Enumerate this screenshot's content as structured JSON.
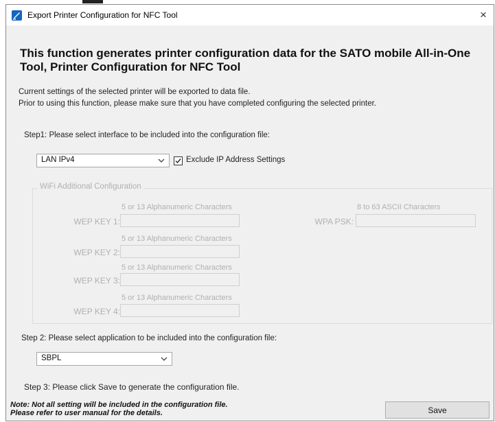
{
  "window": {
    "title": "Export Printer Configuration for NFC Tool",
    "close_glyph": "×"
  },
  "heading": "This function generates printer configuration data for the SATO mobile All-in-One Tool, Printer Configuration for NFC Tool",
  "description": {
    "line1": "Current settings of the selected printer will be exported to data file.",
    "line2": "Prior to using this function, please make sure that you have completed configuring the selected printer."
  },
  "step1": {
    "label": "Step1: Please select interface to be included into the configuration file:",
    "interface_value": "LAN IPv4",
    "exclude_ip": {
      "label": "Exclude IP Address Settings",
      "checked": true
    }
  },
  "wifi": {
    "group_title": "WiFi Additional Configuration",
    "wep_hint": "5 or 13 Alphanumeric Characters",
    "wep_keys": [
      {
        "label": "WEP KEY 1:",
        "value": ""
      },
      {
        "label": "WEP KEY 2:",
        "value": ""
      },
      {
        "label": "WEP KEY 3:",
        "value": ""
      },
      {
        "label": "WEP KEY 4:",
        "value": ""
      }
    ],
    "wpa_hint": "8 to 63 ASCII Characters",
    "wpa_label": "WPA PSK:",
    "wpa_value": ""
  },
  "step2": {
    "label": "Step 2: Please select application to be included into the configuration file:",
    "application_value": "SBPL"
  },
  "step3": {
    "label": "Step 3: Please click Save to generate the configuration file."
  },
  "note": {
    "line1": "Note: Not all setting will be included in the configuration file.",
    "line2": "Please refer to user manual for the details."
  },
  "save_label": "Save",
  "colors": {
    "app_icon": "#1565c0",
    "disabled_text": "#b0b0b0",
    "dialog_bg": "#f0f0f0"
  },
  "icons": {
    "app": "printer-app-icon",
    "close": "close-icon",
    "dropdown": "chevron-down-icon",
    "check": "checkmark-icon"
  }
}
